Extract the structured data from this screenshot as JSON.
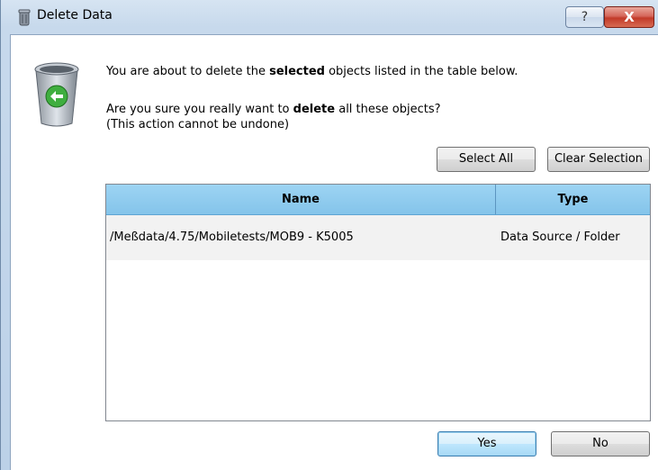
{
  "window": {
    "title": "Delete Data",
    "help_label": "?",
    "close_label": "X"
  },
  "message": {
    "line1_pre": "You are about to delete the ",
    "line1_bold": "selected",
    "line1_post": " objects listed in the table below.",
    "line2_pre": "Are you sure you really want to ",
    "line2_bold": "delete",
    "line2_post": " all these objects?",
    "line3": "(This action cannot be undone)"
  },
  "toolbar": {
    "select_all": "Select All",
    "clear_selection": "Clear Selection"
  },
  "table": {
    "columns": [
      "Name",
      "Type"
    ],
    "rows": [
      {
        "name": "/Meßdata/4.75/Mobiletests/MOB9 - K5005",
        "type": "Data Source / Folder"
      }
    ]
  },
  "buttons": {
    "yes": "Yes",
    "no": "No"
  },
  "icons": {
    "title": "trash-bin-icon",
    "dialog": "recycle-bin-icon"
  },
  "colors": {
    "header_blue": "#9dd4f3",
    "close_red": "#c23a29",
    "primary_border": "#3c7fb1"
  }
}
